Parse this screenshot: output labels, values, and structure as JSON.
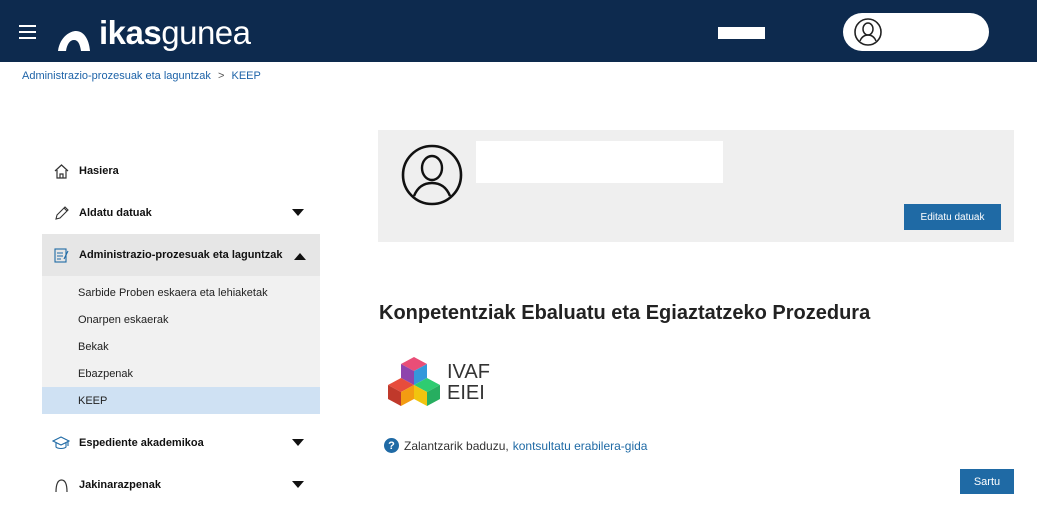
{
  "header": {
    "logo_bold": "ikas",
    "logo_light": "gunea"
  },
  "breadcrumb": {
    "parent": "Administrazio-prozesuak eta laguntzak",
    "separator": ">",
    "current": "KEEP"
  },
  "sidebar": {
    "items": [
      {
        "label": "Hasiera",
        "icon": "home-icon"
      },
      {
        "label": "Aldatu datuak",
        "icon": "pencil-icon"
      },
      {
        "label": "Administrazio-prozesuak eta laguntzak",
        "icon": "form-icon"
      },
      {
        "label": "Espediente akademikoa",
        "icon": "graduation-cap-icon"
      },
      {
        "label": "Jakinarazpenak",
        "icon": "bell-icon"
      }
    ],
    "subitems": [
      "Sarbide Proben eskaera eta lehiaketak",
      "Onarpen eskaerak",
      "Bekak",
      "Ebazpenak",
      "KEEP"
    ]
  },
  "profile": {
    "edit_label": "Editatu datuak"
  },
  "main": {
    "title": "Konpetentziak Ebaluatu eta Egiaztatzeko Prozedura",
    "logo_line1": "IVAF",
    "logo_line2": "EIEI",
    "help_text": "Zalantzarik baduzu,",
    "help_link": "kontsultatu erabilera-gida",
    "enter_label": "Sartu"
  },
  "colors": {
    "topbar": "#0d2a4e",
    "accent": "#1f6aa5",
    "selected": "#cfe1f3"
  }
}
